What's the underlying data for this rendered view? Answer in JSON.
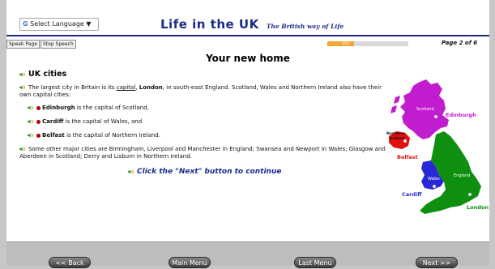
{
  "header": {
    "language_select": "Select Language",
    "title": "Life in the UK",
    "subtitle": "The British way of Life"
  },
  "toolbar": {
    "speak_page": "Speak Page",
    "stop_speech": "Stop Speech",
    "progress_label": "33%",
    "progress_fraction": 0.33,
    "page_indicator": "Page 2 of 6"
  },
  "content": {
    "heading": "Your new home",
    "subheading": "UK cities",
    "intro_1": "The largest city in Britain is its ",
    "intro_link": "capital",
    "intro_2": ", ",
    "intro_bold": "London",
    "intro_3": ", in south-east England. Scotland, Wales and Northern Ireland also have their own capital cities:",
    "bullets": [
      {
        "city": "Edinburgh",
        "text": " is the capital of Scotland,"
      },
      {
        "city": "Cardiff",
        "text": " is the capital of Wales, and"
      },
      {
        "city": "Belfast",
        "text": " is the capital of Northern Ireland."
      }
    ],
    "other_cities": "Some other major cities are Birmingham, Liverpool and Manchester in England; Swansea and Newport in Wales; Glasgow and Aberdeen in Scotland; Derry and Lisburn in Northern Ireland.",
    "call_to_action": "Click the \"Next\" button to continue"
  },
  "map": {
    "labels": {
      "scotland": "Scotland",
      "edinburgh": "Edinburgh",
      "northern_ireland_1": "Northern",
      "northern_ireland_2": "Ireland",
      "belfast": "Belfast",
      "england": "England",
      "wales": "Wales",
      "cardiff": "Cardiff",
      "london": "London"
    },
    "colors": {
      "scotland": "#c21ccf",
      "northern_ireland": "#e01010",
      "wales": "#2828d8",
      "england": "#0f8f0f"
    }
  },
  "footer": {
    "back": "<< Back",
    "main_menu": "Main Menu",
    "last_menu": "Last Menu",
    "next": "Next >>"
  },
  "colors": {
    "brand": "#1c2b8a",
    "progress": "#f2a638"
  }
}
